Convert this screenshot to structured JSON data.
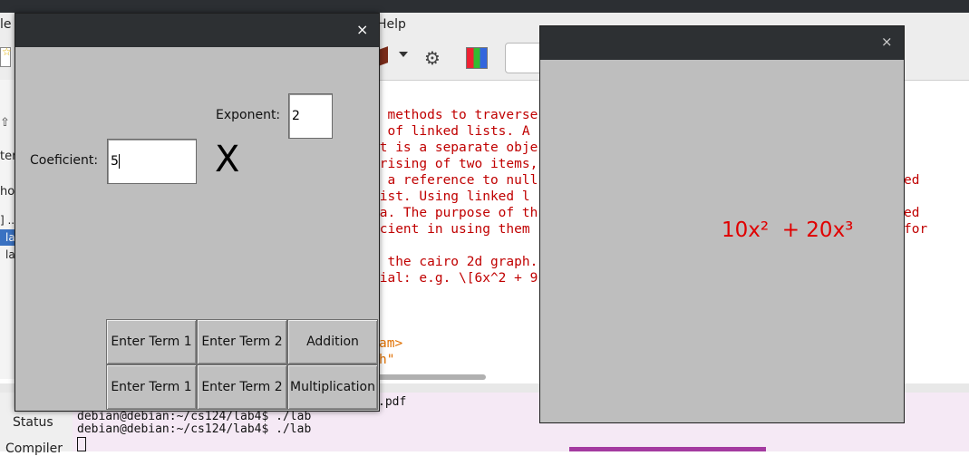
{
  "background_app": {
    "menu_partial_left": "le",
    "menu_help": "Help",
    "editor_lines": [
      "t methods to traverse",
      "t of linked lists. A",
      "nt is a separate obje",
      "prising of two items,",
      "s a reference to null",
      "list. Using linked l",
      "ta. The purpose of th",
      "icient in using them",
      "",
      "s the cairo 2d graph.",
      "mial: e.g. \\[6x^2 + 9"
    ],
    "editor_right_fragments": [
      "ed",
      "ed",
      "for"
    ],
    "editor_orange_lines": [
      "am>",
      "h\""
    ],
    "sidebar_fragments": [
      "le",
      "ter",
      "ho",
      "] ..",
      "la",
      "la"
    ],
    "terminal_lines": [
      ".pdf",
      "debian@debian:~/cs124/lab4$ ./lab",
      "debian@debian:~/cs124/lab4$ ./lab"
    ],
    "bottom_tabs": [
      "Status",
      "Compiler"
    ]
  },
  "input_dialog": {
    "close_glyph": "×",
    "coefficient_label": "Coeficient:",
    "coefficient_value": "5",
    "exponent_label": "Exponent:",
    "exponent_value": "2",
    "variable_symbol": "X",
    "buttons_row1": [
      "Enter Term 1",
      "Enter Term 2",
      "Addition"
    ],
    "buttons_row2": [
      "Enter Term 1",
      "Enter Term 2",
      "Multiplication"
    ]
  },
  "result_window": {
    "close_glyph": "×",
    "polynomial_text": "10x²  + 20x³",
    "text_color": "#e00000"
  }
}
